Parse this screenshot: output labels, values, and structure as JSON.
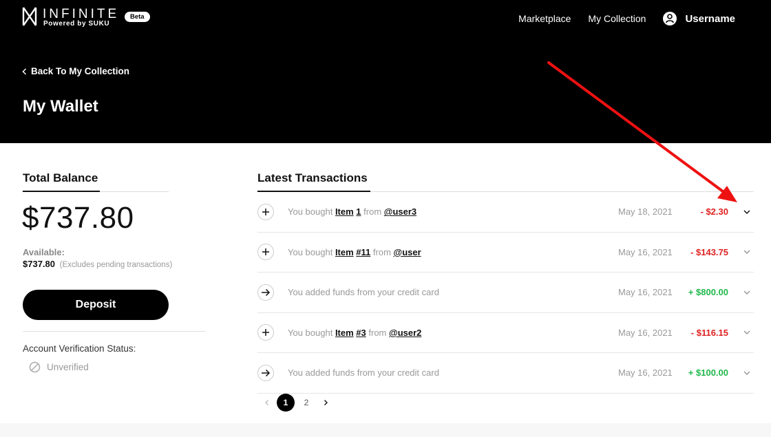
{
  "header": {
    "brand_name": "INFINITE",
    "brand_sub": "Powered by SUKU",
    "beta": "Beta",
    "nav": [
      "Marketplace",
      "My Collection"
    ],
    "username": "Username",
    "back_label": "Back To My Collection",
    "page_title": "My Wallet"
  },
  "balance": {
    "title": "Total Balance",
    "amount": "$737.80",
    "available_label": "Available:",
    "available_value": "$737.80",
    "available_note": "(Excludes pending transactions)",
    "deposit_label": "Deposit",
    "verification_label": "Account Verification Status:",
    "verification_status": "Unverified"
  },
  "transactions": {
    "title": "Latest Transactions",
    "rows": [
      {
        "type": "purchase",
        "prefix": "You bought",
        "item": "Item",
        "item_num": "1",
        "from": "from",
        "user": "@user3",
        "date": "May 18, 2021",
        "amount": "- $2.30",
        "sign": "neg"
      },
      {
        "type": "purchase",
        "prefix": "You bought",
        "item": "Item",
        "item_num": "#11",
        "from": "from",
        "user": "@user",
        "date": "May 16, 2021",
        "amount": "- $143.75",
        "sign": "neg"
      },
      {
        "type": "deposit",
        "text": "You added funds from your credit card",
        "date": "May 16, 2021",
        "amount": "+ $800.00",
        "sign": "pos"
      },
      {
        "type": "purchase",
        "prefix": "You bought",
        "item": "Item",
        "item_num": "#3",
        "from": "from",
        "user": "@user2",
        "date": "May 16, 2021",
        "amount": "- $116.15",
        "sign": "neg"
      },
      {
        "type": "deposit",
        "text": "You added funds from your credit card",
        "date": "May 16, 2021",
        "amount": "+ $100.00",
        "sign": "pos"
      }
    ]
  },
  "pagination": {
    "pages": [
      "1",
      "2"
    ],
    "current": "1"
  },
  "colors": {
    "negative": "#e02020",
    "positive": "#1fb84a",
    "annotation": "#ee1111"
  },
  "icons": {
    "purchase": "plus-icon",
    "deposit": "arrow-right-icon",
    "expand": "chevron-down-icon",
    "back": "chevron-left-icon",
    "user": "user-icon",
    "unverified": "no-entry-icon"
  }
}
